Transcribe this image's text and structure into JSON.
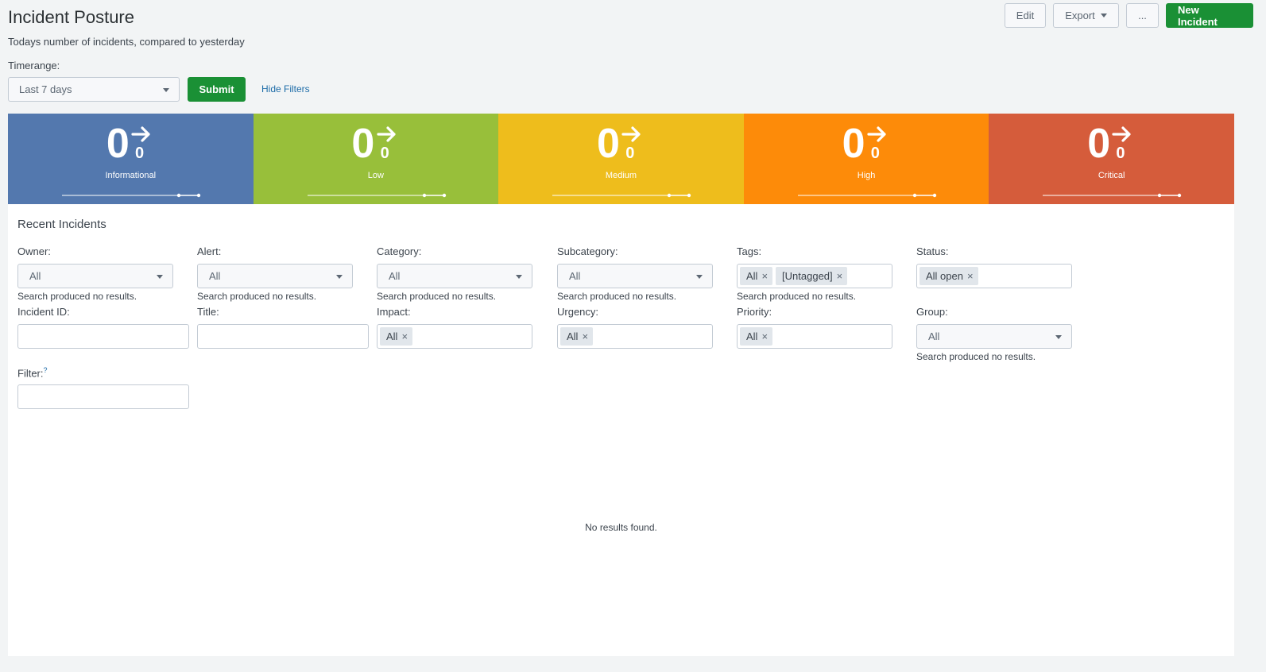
{
  "header": {
    "title": "Incident Posture",
    "description": "Todays number of incidents, compared to yesterday",
    "edit_label": "Edit",
    "export_label": "Export",
    "more_label": "...",
    "new_incident_label": "New Incident"
  },
  "timerange": {
    "label": "Timerange:",
    "value": "Last 7 days",
    "submit_label": "Submit",
    "hide_filters_label": "Hide Filters"
  },
  "tiles": [
    {
      "value": "0",
      "delta": "0",
      "label": "Informational",
      "color": "#5378ae"
    },
    {
      "value": "0",
      "delta": "0",
      "label": "Low",
      "color": "#98bf3a"
    },
    {
      "value": "0",
      "delta": "0",
      "label": "Medium",
      "color": "#eebd1c"
    },
    {
      "value": "0",
      "delta": "0",
      "label": "High",
      "color": "#fd8b09"
    },
    {
      "value": "0",
      "delta": "0",
      "label": "Critical",
      "color": "#d55c3b"
    }
  ],
  "recent": {
    "title": "Recent Incidents",
    "owner": {
      "label": "Owner:",
      "value": "All",
      "message": "Search produced no results."
    },
    "alert": {
      "label": "Alert:",
      "value": "All",
      "message": "Search produced no results."
    },
    "category": {
      "label": "Category:",
      "value": "All",
      "message": "Search produced no results."
    },
    "subcategory": {
      "label": "Subcategory:",
      "value": "All",
      "message": "Search produced no results."
    },
    "tags": {
      "label": "Tags:",
      "chips": [
        "All",
        "[Untagged]"
      ],
      "message": "Search produced no results."
    },
    "status": {
      "label": "Status:",
      "chips": [
        "All open"
      ]
    },
    "incident_id": {
      "label": "Incident ID:"
    },
    "title_field": {
      "label": "Title:"
    },
    "impact": {
      "label": "Impact:",
      "chips": [
        "All"
      ]
    },
    "urgency": {
      "label": "Urgency:",
      "chips": [
        "All"
      ]
    },
    "priority": {
      "label": "Priority:",
      "chips": [
        "All"
      ]
    },
    "group": {
      "label": "Group:",
      "value": "All",
      "message": "Search produced no results."
    },
    "filter": {
      "label": "Filter:",
      "help": "?"
    },
    "no_results": "No results found.",
    "chip_remove": "×"
  },
  "colors": {
    "primary_green": "#1a9035",
    "link_blue": "#1e6ca8"
  }
}
